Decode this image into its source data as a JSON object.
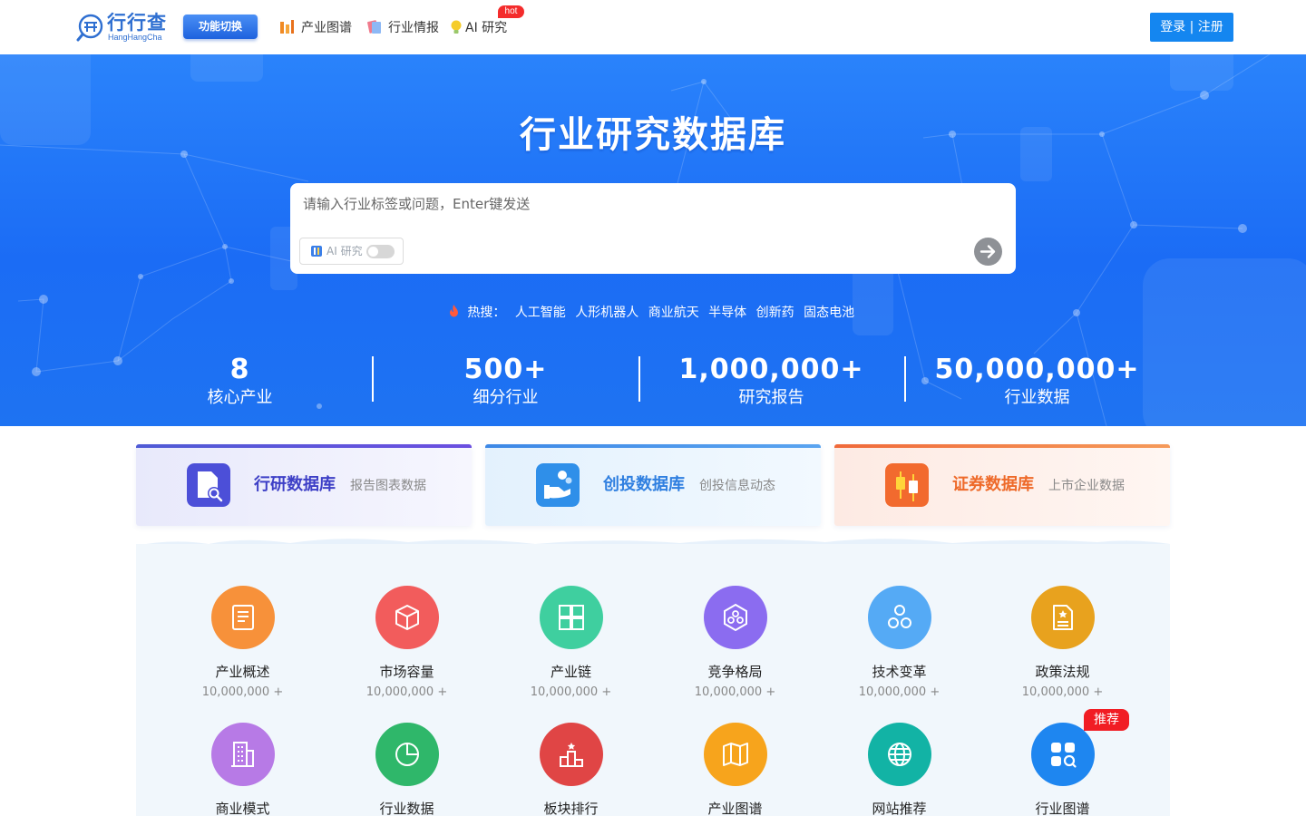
{
  "header": {
    "logo_cn": "行行查",
    "logo_en": "HangHangCha",
    "switch_label": "功能切换",
    "nav": [
      {
        "label": "产业图谱",
        "icon": "industry-chart-icon"
      },
      {
        "label": "行业情报",
        "icon": "intel-icon"
      },
      {
        "label": "AI 研究",
        "icon": "bulb-icon"
      }
    ],
    "hot_badge": "hot",
    "login_label": "登录 | 注册"
  },
  "hero": {
    "title": "行业研究数据库",
    "search": {
      "placeholder": "请输入行业标签或问题，Enter键发送",
      "value": "",
      "ai_toggle_label": "AI 研究",
      "ai_toggle_on": false
    },
    "hot": {
      "label": "热搜：",
      "terms": [
        "人工智能",
        "人形机器人",
        "商业航天",
        "半导体",
        "创新药",
        "固态电池"
      ]
    },
    "stats": [
      {
        "value": "8",
        "label": "核心产业"
      },
      {
        "value": "500+",
        "label": "细分行业"
      },
      {
        "value": "1,000,000+",
        "label": "研究报告"
      },
      {
        "value": "50,000,000+",
        "label": "行业数据"
      }
    ]
  },
  "databases": [
    {
      "title": "行研数据库",
      "subtitle": "报告图表数据",
      "accent": "#4f5bd5"
    },
    {
      "title": "创投数据库",
      "subtitle": "创投信息动态",
      "accent": "#3d88e6"
    },
    {
      "title": "证券数据库",
      "subtitle": "上市企业数据",
      "accent": "#f06a3a"
    }
  ],
  "categories_row1": [
    {
      "name": "产业概述",
      "count": "10,000,000 +",
      "color": "#f7913a",
      "icon": "document-icon"
    },
    {
      "name": "市场容量",
      "count": "10,000,000 +",
      "color": "#f25c5c",
      "icon": "box-icon"
    },
    {
      "name": "产业链",
      "count": "10,000,000 +",
      "color": "#3fcf9f",
      "icon": "blocks-icon"
    },
    {
      "name": "竞争格局",
      "count": "10,000,000 +",
      "color": "#8b6cf0",
      "icon": "hexagon-icon"
    },
    {
      "name": "技术变革",
      "count": "10,000,000 +",
      "color": "#55aaf5",
      "icon": "molecule-icon"
    },
    {
      "name": "政策法规",
      "count": "10,000,000 +",
      "color": "#e8a21e",
      "icon": "policy-icon"
    }
  ],
  "categories_row2": [
    {
      "name": "商业模式",
      "color": "#b77ae6",
      "icon": "building-icon"
    },
    {
      "name": "行业数据",
      "color": "#2fb76a",
      "icon": "pie-icon"
    },
    {
      "name": "板块排行",
      "color": "#e04545",
      "icon": "podium-icon"
    },
    {
      "name": "产业图谱",
      "color": "#f7a41c",
      "icon": "map-icon"
    },
    {
      "name": "网站推荐",
      "color": "#12b3a5",
      "icon": "globe-icon"
    },
    {
      "name": "行业图谱",
      "color": "#1e86f0",
      "icon": "grid-search-icon"
    }
  ],
  "recommend_badge": "推荐"
}
